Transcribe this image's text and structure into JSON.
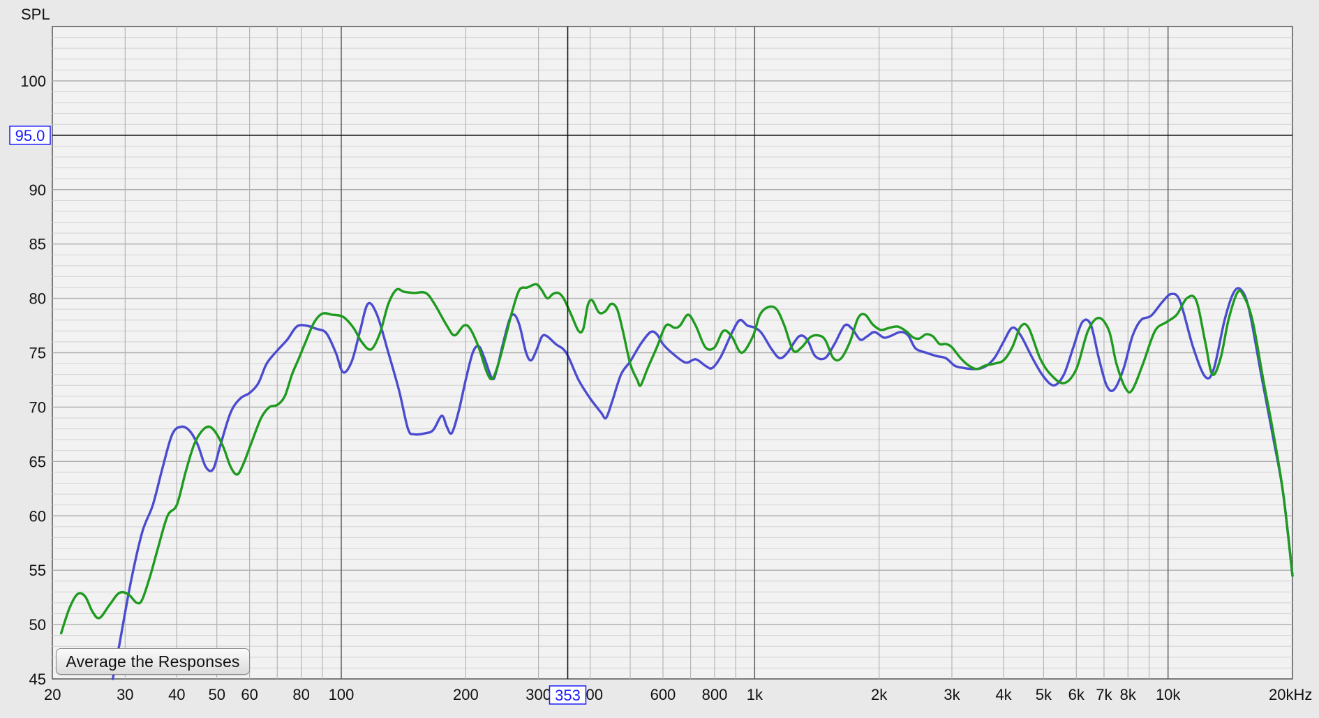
{
  "chart_data": {
    "type": "line",
    "ylabel": "SPL",
    "x_scale": "log",
    "xlim": [
      20,
      20000
    ],
    "ylim": [
      45,
      105
    ],
    "grid": true,
    "x_tick_labels": [
      "20",
      "30",
      "40",
      "50",
      "60",
      "80",
      "100",
      "200",
      "300",
      "400",
      "600",
      "800",
      "1k",
      "2k",
      "3k",
      "4k",
      "5k",
      "6k",
      "7k",
      "8k",
      "10k",
      "20kHz"
    ],
    "x_tick_values": [
      20,
      30,
      40,
      50,
      60,
      80,
      100,
      200,
      300,
      400,
      600,
      800,
      1000,
      2000,
      3000,
      4000,
      5000,
      6000,
      7000,
      8000,
      10000,
      20000
    ],
    "y_tick_labels": [
      "45",
      "50",
      "55",
      "60",
      "65",
      "70",
      "75",
      "80",
      "85",
      "90",
      "100"
    ],
    "y_tick_values": [
      45,
      50,
      55,
      60,
      65,
      70,
      75,
      80,
      85,
      90,
      100
    ],
    "cursor": {
      "x_label": "353",
      "y_label": "95.0",
      "x_value": 353,
      "y_value": 95.0
    },
    "series": [
      {
        "color": "#4b4bd0",
        "points": [
          [
            28,
            45
          ],
          [
            29,
            48
          ],
          [
            31,
            54
          ],
          [
            33,
            58.5
          ],
          [
            35,
            61
          ],
          [
            37,
            64.5
          ],
          [
            39,
            67.5
          ],
          [
            41,
            68.2
          ],
          [
            43,
            67.8
          ],
          [
            45,
            66.5
          ],
          [
            47,
            64.5
          ],
          [
            49,
            64.3
          ],
          [
            51,
            66.5
          ],
          [
            54,
            69.5
          ],
          [
            57,
            70.8
          ],
          [
            60,
            71.3
          ],
          [
            63,
            72.2
          ],
          [
            66,
            74
          ],
          [
            70,
            75.2
          ],
          [
            74,
            76.2
          ],
          [
            78,
            77.4
          ],
          [
            82,
            77.5
          ],
          [
            87,
            77.2
          ],
          [
            92,
            76.8
          ],
          [
            97,
            75
          ],
          [
            101,
            73.2
          ],
          [
            106,
            74.2
          ],
          [
            111,
            77
          ],
          [
            116,
            79.5
          ],
          [
            122,
            78.5
          ],
          [
            130,
            75
          ],
          [
            138,
            71.5
          ],
          [
            145,
            68
          ],
          [
            150,
            67.5
          ],
          [
            160,
            67.6
          ],
          [
            167,
            67.9
          ],
          [
            175,
            69.2
          ],
          [
            180,
            68.2
          ],
          [
            185,
            67.6
          ],
          [
            192,
            69.5
          ],
          [
            200,
            72.5
          ],
          [
            208,
            75
          ],
          [
            215,
            75.6
          ],
          [
            222,
            74.5
          ],
          [
            232,
            72.6
          ],
          [
            238,
            73.5
          ],
          [
            245,
            75.5
          ],
          [
            255,
            78
          ],
          [
            262,
            78.5
          ],
          [
            270,
            77.5
          ],
          [
            280,
            75
          ],
          [
            288,
            74.3
          ],
          [
            297,
            75.3
          ],
          [
            306,
            76.5
          ],
          [
            315,
            76.5
          ],
          [
            330,
            75.8
          ],
          [
            350,
            75
          ],
          [
            375,
            72.5
          ],
          [
            400,
            70.8
          ],
          [
            425,
            69.5
          ],
          [
            437,
            69
          ],
          [
            452,
            70.5
          ],
          [
            475,
            73
          ],
          [
            500,
            74.2
          ],
          [
            530,
            75.8
          ],
          [
            560,
            76.9
          ],
          [
            580,
            76.7
          ],
          [
            600,
            75.8
          ],
          [
            630,
            75
          ],
          [
            680,
            74.1
          ],
          [
            720,
            74.4
          ],
          [
            760,
            73.8
          ],
          [
            790,
            73.6
          ],
          [
            830,
            74.7
          ],
          [
            880,
            76.8
          ],
          [
            920,
            78
          ],
          [
            960,
            77.5
          ],
          [
            1000,
            77.3
          ],
          [
            1040,
            76.8
          ],
          [
            1100,
            75.3
          ],
          [
            1150,
            74.5
          ],
          [
            1200,
            75
          ],
          [
            1280,
            76.5
          ],
          [
            1340,
            76.2
          ],
          [
            1400,
            74.7
          ],
          [
            1480,
            74.5
          ],
          [
            1560,
            75.8
          ],
          [
            1650,
            77.5
          ],
          [
            1720,
            77.2
          ],
          [
            1800,
            76.2
          ],
          [
            1870,
            76.5
          ],
          [
            1950,
            76.9
          ],
          [
            2050,
            76.4
          ],
          [
            2120,
            76.5
          ],
          [
            2250,
            76.9
          ],
          [
            2350,
            76.6
          ],
          [
            2450,
            75.4
          ],
          [
            2600,
            75
          ],
          [
            2750,
            74.7
          ],
          [
            2900,
            74.5
          ],
          [
            3050,
            73.8
          ],
          [
            3200,
            73.6
          ],
          [
            3400,
            73.5
          ],
          [
            3600,
            73.7
          ],
          [
            3800,
            74.5
          ],
          [
            4000,
            76
          ],
          [
            4200,
            77.3
          ],
          [
            4400,
            76.6
          ],
          [
            4700,
            74.5
          ],
          [
            5000,
            72.8
          ],
          [
            5300,
            72
          ],
          [
            5600,
            73
          ],
          [
            5900,
            75.5
          ],
          [
            6200,
            77.8
          ],
          [
            6500,
            77.6
          ],
          [
            6800,
            74.5
          ],
          [
            7100,
            72
          ],
          [
            7400,
            71.6
          ],
          [
            7800,
            73.5
          ],
          [
            8200,
            76.5
          ],
          [
            8600,
            78
          ],
          [
            9100,
            78.4
          ],
          [
            9700,
            79.7
          ],
          [
            10200,
            80.4
          ],
          [
            10700,
            79.7
          ],
          [
            11500,
            75.5
          ],
          [
            12300,
            72.8
          ],
          [
            12900,
            73.5
          ],
          [
            13700,
            78
          ],
          [
            14400,
            80.5
          ],
          [
            15000,
            80.8
          ],
          [
            15700,
            79
          ],
          [
            16800,
            73
          ],
          [
            18000,
            67
          ],
          [
            19000,
            62
          ],
          [
            20000,
            54.5
          ]
        ]
      },
      {
        "color": "#1e9a1e",
        "points": [
          [
            21,
            49.2
          ],
          [
            22,
            51.5
          ],
          [
            23,
            52.8
          ],
          [
            24,
            52.6
          ],
          [
            25,
            51.2
          ],
          [
            26,
            50.6
          ],
          [
            27.5,
            51.8
          ],
          [
            29,
            52.9
          ],
          [
            30.5,
            52.8
          ],
          [
            32,
            52
          ],
          [
            33,
            52.3
          ],
          [
            34.5,
            54.5
          ],
          [
            36,
            57
          ],
          [
            38,
            60
          ],
          [
            40,
            61
          ],
          [
            42,
            64
          ],
          [
            44,
            66.5
          ],
          [
            46,
            67.8
          ],
          [
            48,
            68.2
          ],
          [
            50,
            67.5
          ],
          [
            52,
            66.2
          ],
          [
            54,
            64.5
          ],
          [
            56,
            63.8
          ],
          [
            58,
            64.8
          ],
          [
            61,
            67
          ],
          [
            64,
            69
          ],
          [
            67,
            70
          ],
          [
            70,
            70.2
          ],
          [
            73,
            71
          ],
          [
            76,
            73
          ],
          [
            79,
            74.5
          ],
          [
            82,
            76
          ],
          [
            86,
            77.8
          ],
          [
            90,
            78.6
          ],
          [
            95,
            78.5
          ],
          [
            101,
            78.3
          ],
          [
            107,
            77.3
          ],
          [
            112,
            76
          ],
          [
            118,
            75.3
          ],
          [
            124,
            76.8
          ],
          [
            130,
            79.5
          ],
          [
            136,
            80.8
          ],
          [
            142,
            80.6
          ],
          [
            150,
            80.5
          ],
          [
            160,
            80.5
          ],
          [
            168,
            79.5
          ],
          [
            180,
            77.5
          ],
          [
            188,
            76.6
          ],
          [
            198,
            77.5
          ],
          [
            205,
            77.2
          ],
          [
            215,
            75.5
          ],
          [
            225,
            73.2
          ],
          [
            232,
            72.6
          ],
          [
            240,
            74
          ],
          [
            250,
            76.5
          ],
          [
            260,
            79
          ],
          [
            270,
            80.8
          ],
          [
            282,
            81
          ],
          [
            296,
            81.3
          ],
          [
            305,
            80.8
          ],
          [
            315,
            80
          ],
          [
            325,
            80.4
          ],
          [
            335,
            80.5
          ],
          [
            345,
            80
          ],
          [
            360,
            78.5
          ],
          [
            375,
            77
          ],
          [
            385,
            77.2
          ],
          [
            395,
            79.4
          ],
          [
            405,
            79.8
          ],
          [
            420,
            78.7
          ],
          [
            435,
            78.8
          ],
          [
            450,
            79.5
          ],
          [
            465,
            79
          ],
          [
            480,
            77
          ],
          [
            500,
            74
          ],
          [
            520,
            72.5
          ],
          [
            530,
            72
          ],
          [
            550,
            73.5
          ],
          [
            580,
            75.5
          ],
          [
            610,
            77.5
          ],
          [
            640,
            77.3
          ],
          [
            660,
            77.5
          ],
          [
            690,
            78.5
          ],
          [
            720,
            77.5
          ],
          [
            760,
            75.5
          ],
          [
            800,
            75.5
          ],
          [
            840,
            77
          ],
          [
            880,
            76.5
          ],
          [
            930,
            75
          ],
          [
            990,
            76.5
          ],
          [
            1030,
            78.5
          ],
          [
            1080,
            79.2
          ],
          [
            1130,
            79
          ],
          [
            1180,
            77.5
          ],
          [
            1240,
            75.2
          ],
          [
            1300,
            75.5
          ],
          [
            1360,
            76.4
          ],
          [
            1420,
            76.6
          ],
          [
            1480,
            76.2
          ],
          [
            1550,
            74.5
          ],
          [
            1620,
            74.5
          ],
          [
            1700,
            76
          ],
          [
            1780,
            78.2
          ],
          [
            1850,
            78.5
          ],
          [
            1930,
            77.6
          ],
          [
            2020,
            77.1
          ],
          [
            2120,
            77.3
          ],
          [
            2220,
            77.4
          ],
          [
            2320,
            77
          ],
          [
            2420,
            76.4
          ],
          [
            2500,
            76.3
          ],
          [
            2600,
            76.7
          ],
          [
            2700,
            76.5
          ],
          [
            2800,
            75.8
          ],
          [
            2900,
            75.8
          ],
          [
            3000,
            75.5
          ],
          [
            3150,
            74.5
          ],
          [
            3300,
            73.8
          ],
          [
            3450,
            73.5
          ],
          [
            3600,
            73.8
          ],
          [
            3800,
            74
          ],
          [
            4000,
            74.3
          ],
          [
            4200,
            75.5
          ],
          [
            4400,
            77.4
          ],
          [
            4600,
            77.3
          ],
          [
            4900,
            74.5
          ],
          [
            5200,
            73
          ],
          [
            5600,
            72.2
          ],
          [
            6000,
            73.5
          ],
          [
            6400,
            77
          ],
          [
            6800,
            78.2
          ],
          [
            7200,
            77
          ],
          [
            7500,
            74
          ],
          [
            7900,
            71.7
          ],
          [
            8200,
            71.6
          ],
          [
            8700,
            74
          ],
          [
            9300,
            77
          ],
          [
            9900,
            77.8
          ],
          [
            10500,
            78.5
          ],
          [
            11100,
            80
          ],
          [
            11700,
            79.8
          ],
          [
            12300,
            76
          ],
          [
            12800,
            73
          ],
          [
            13400,
            74.5
          ],
          [
            14000,
            78
          ],
          [
            14700,
            80.5
          ],
          [
            15200,
            80.3
          ],
          [
            16000,
            78
          ],
          [
            17000,
            72.5
          ],
          [
            18000,
            67.5
          ],
          [
            19000,
            62
          ],
          [
            20000,
            54.5
          ]
        ]
      }
    ]
  },
  "controls": {
    "average_button_label": "Average the Responses"
  }
}
